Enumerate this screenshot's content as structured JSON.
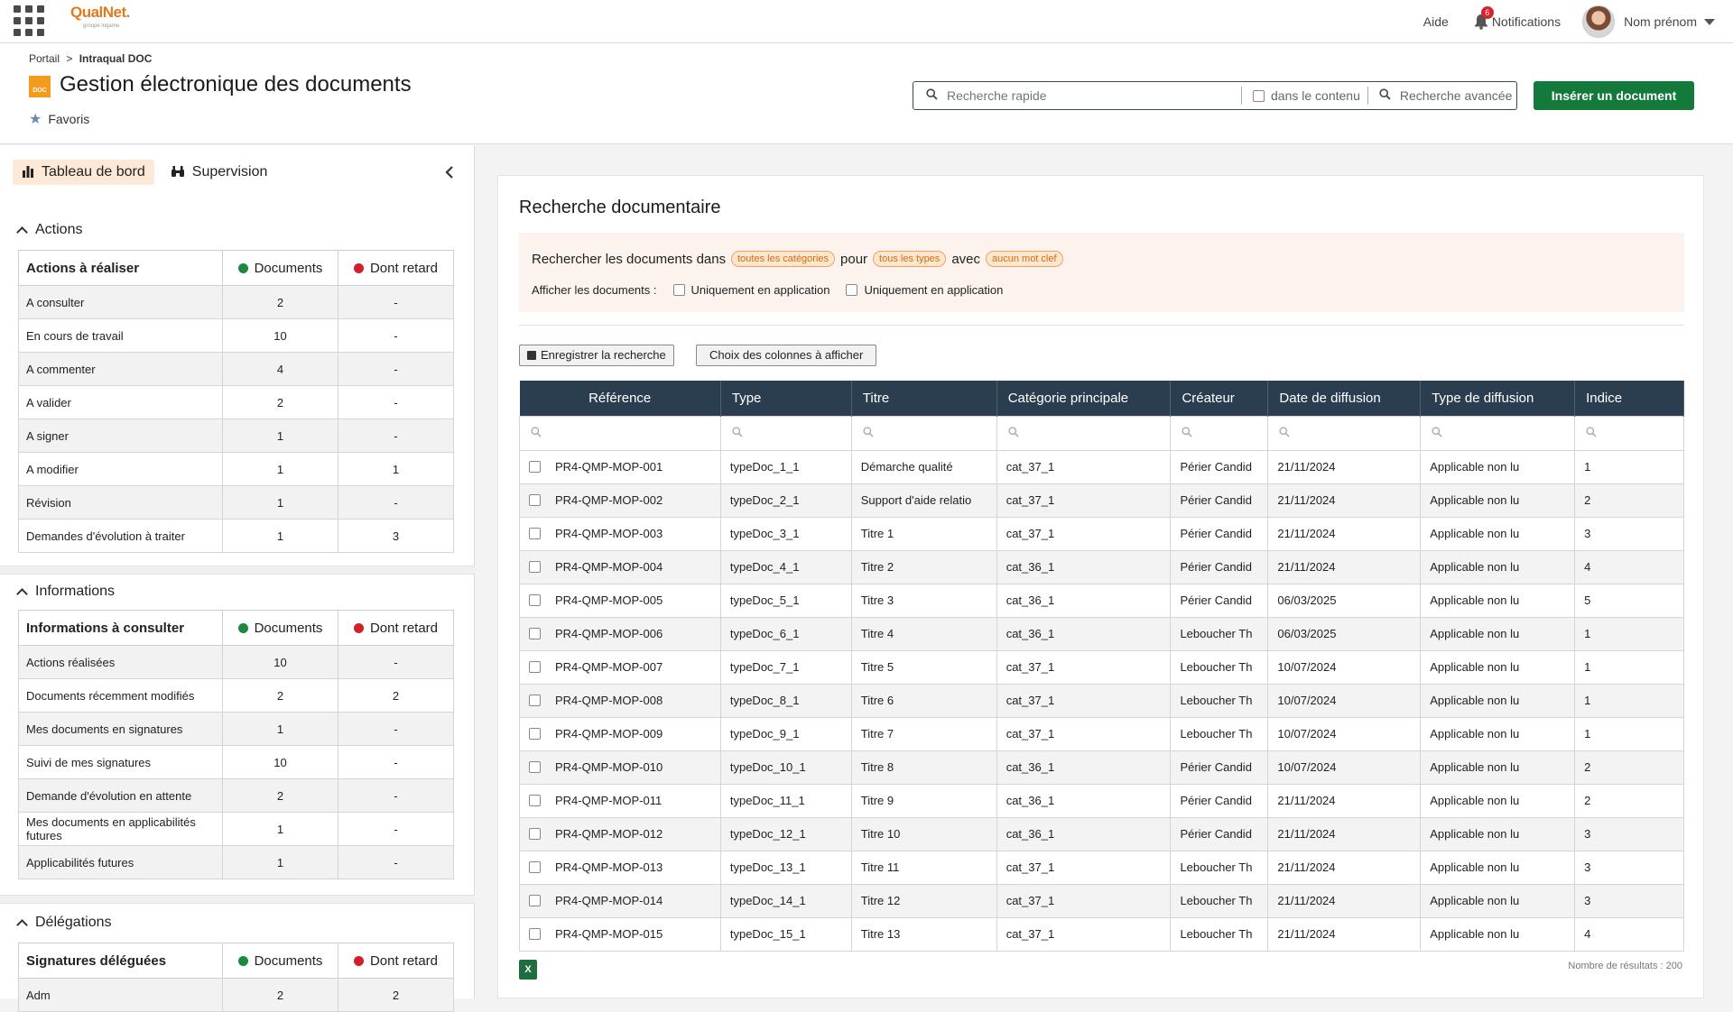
{
  "topbar": {
    "logo_name": "QualNet.",
    "logo_sub": "groupe inqame",
    "help": "Aide",
    "notif_count": "6",
    "notifications": "Notifications",
    "user_name": "Nom prénom"
  },
  "header": {
    "breadcrumb_root": "Portail",
    "breadcrumb_sep": ">",
    "breadcrumb_current": "Intraqual DOC",
    "page_icon_text": "DOC",
    "title": "Gestion électronique des documents",
    "favorites": "Favoris",
    "search_placeholder": "Recherche rapide",
    "in_content": "dans le contenu",
    "advanced_search": "Recherche avancée",
    "insert_button": "Insérer un document"
  },
  "left": {
    "tab_dashboard": "Tableau de bord",
    "tab_supervision": "Supervision",
    "legend_documents": "Documents",
    "legend_late": "Dont retard",
    "color_documents": "#1a8a3c",
    "color_late": "#d0202a",
    "actions": {
      "section": "Actions",
      "header": "Actions à réaliser",
      "rows": [
        {
          "label": "A consulter",
          "docs": "2",
          "late": "-"
        },
        {
          "label": "En cours de travail",
          "docs": "10",
          "late": "-"
        },
        {
          "label": "A commenter",
          "docs": "4",
          "late": "-"
        },
        {
          "label": "A valider",
          "docs": "2",
          "late": "-"
        },
        {
          "label": "A signer",
          "docs": "1",
          "late": "-"
        },
        {
          "label": "A modifier",
          "docs": "1",
          "late": "1"
        },
        {
          "label": "Révision",
          "docs": "1",
          "late": "-"
        },
        {
          "label": "Demandes d'évolution à traiter",
          "docs": "1",
          "late": "3"
        }
      ]
    },
    "infos": {
      "section": "Informations",
      "header": "Informations à consulter",
      "rows": [
        {
          "label": "Actions réalisées",
          "docs": "10",
          "late": "-"
        },
        {
          "label": "Documents récemment modifiés",
          "docs": "2",
          "late": "2"
        },
        {
          "label": "Mes documents en signatures",
          "docs": "1",
          "late": "-"
        },
        {
          "label": "Suivi de mes signatures",
          "docs": "10",
          "late": "-"
        },
        {
          "label": "Demande d'évolution en attente",
          "docs": "2",
          "late": "-"
        },
        {
          "label": "Mes documents en applicabilités futures",
          "docs": "1",
          "late": "-"
        },
        {
          "label": "Applicabilités futures",
          "docs": "1",
          "late": "-"
        }
      ]
    },
    "delegations": {
      "section": "Délégations",
      "header": "Signatures déléguées",
      "rows": [
        {
          "label": "Adm",
          "docs": "2",
          "late": "2"
        }
      ]
    }
  },
  "main": {
    "title": "Recherche documentaire",
    "filter_prefix": "Rechercher les documents dans",
    "pill_categories": "toutes les catégories",
    "filter_for": "pour",
    "pill_types": "tous les types",
    "filter_with": "avec",
    "pill_keywords": "aucun mot clef",
    "show_docs": "Afficher les documents :",
    "option1": "Uniquement en application",
    "option2": "Uniquement en application",
    "save_search": "Enregistrer la recherche",
    "choose_columns": "Choix des colonnes à afficher",
    "columns": [
      "Référence",
      "Type",
      "Titre",
      "Catégorie principale",
      "Créateur",
      "Date de diffusion",
      "Type de diffusion",
      "Indice"
    ],
    "rows": [
      [
        "PR4-QMP-MOP-001",
        "typeDoc_1_1",
        "Démarche qualité",
        "cat_37_1",
        "Périer Candid",
        "21/11/2024",
        "Applicable non lu",
        "1"
      ],
      [
        "PR4-QMP-MOP-002",
        "typeDoc_2_1",
        "Support d'aide relatio",
        "cat_37_1",
        "Périer Candid",
        "21/11/2024",
        "Applicable non lu",
        "2"
      ],
      [
        "PR4-QMP-MOP-003",
        "typeDoc_3_1",
        "Titre 1",
        "cat_37_1",
        "Périer Candid",
        "21/11/2024",
        "Applicable non lu",
        "3"
      ],
      [
        "PR4-QMP-MOP-004",
        "typeDoc_4_1",
        "Titre 2",
        "cat_36_1",
        "Périer Candid",
        "21/11/2024",
        "Applicable non lu",
        "4"
      ],
      [
        "PR4-QMP-MOP-005",
        "typeDoc_5_1",
        "Titre 3",
        "cat_36_1",
        "Périer Candid",
        "06/03/2025",
        "Applicable non lu",
        "5"
      ],
      [
        "PR4-QMP-MOP-006",
        "typeDoc_6_1",
        "Titre 4",
        "cat_36_1",
        "Leboucher Th",
        "06/03/2025",
        "Applicable non lu",
        "1"
      ],
      [
        "PR4-QMP-MOP-007",
        "typeDoc_7_1",
        "Titre 5",
        "cat_37_1",
        "Leboucher Th",
        "10/07/2024",
        "Applicable non lu",
        "1"
      ],
      [
        "PR4-QMP-MOP-008",
        "typeDoc_8_1",
        "Titre 6",
        "cat_37_1",
        "Leboucher Th",
        "10/07/2024",
        "Applicable non lu",
        "1"
      ],
      [
        "PR4-QMP-MOP-009",
        "typeDoc_9_1",
        "Titre 7",
        "cat_37_1",
        "Leboucher Th",
        "10/07/2024",
        "Applicable non lu",
        "1"
      ],
      [
        "PR4-QMP-MOP-010",
        "typeDoc_10_1",
        "Titre 8",
        "cat_36_1",
        "Périer Candid",
        "10/07/2024",
        "Applicable non lu",
        "2"
      ],
      [
        "PR4-QMP-MOP-011",
        "typeDoc_11_1",
        "Titre 9",
        "cat_36_1",
        "Périer Candid",
        "21/11/2024",
        "Applicable non lu",
        "2"
      ],
      [
        "PR4-QMP-MOP-012",
        "typeDoc_12_1",
        "Titre 10",
        "cat_36_1",
        "Périer Candid",
        "21/11/2024",
        "Applicable non lu",
        "3"
      ],
      [
        "PR4-QMP-MOP-013",
        "typeDoc_13_1",
        "Titre 11",
        "cat_37_1",
        "Leboucher Th",
        "21/11/2024",
        "Applicable non lu",
        "3"
      ],
      [
        "PR4-QMP-MOP-014",
        "typeDoc_14_1",
        "Titre 12",
        "cat_37_1",
        "Leboucher Th",
        "21/11/2024",
        "Applicable non lu",
        "3"
      ],
      [
        "PR4-QMP-MOP-015",
        "typeDoc_15_1",
        "Titre 13",
        "cat_37_1",
        "Leboucher Th",
        "21/11/2024",
        "Applicable non lu",
        "4"
      ]
    ],
    "result_count": "Nombre de résultats : 200",
    "excel_icon_label": "X"
  }
}
